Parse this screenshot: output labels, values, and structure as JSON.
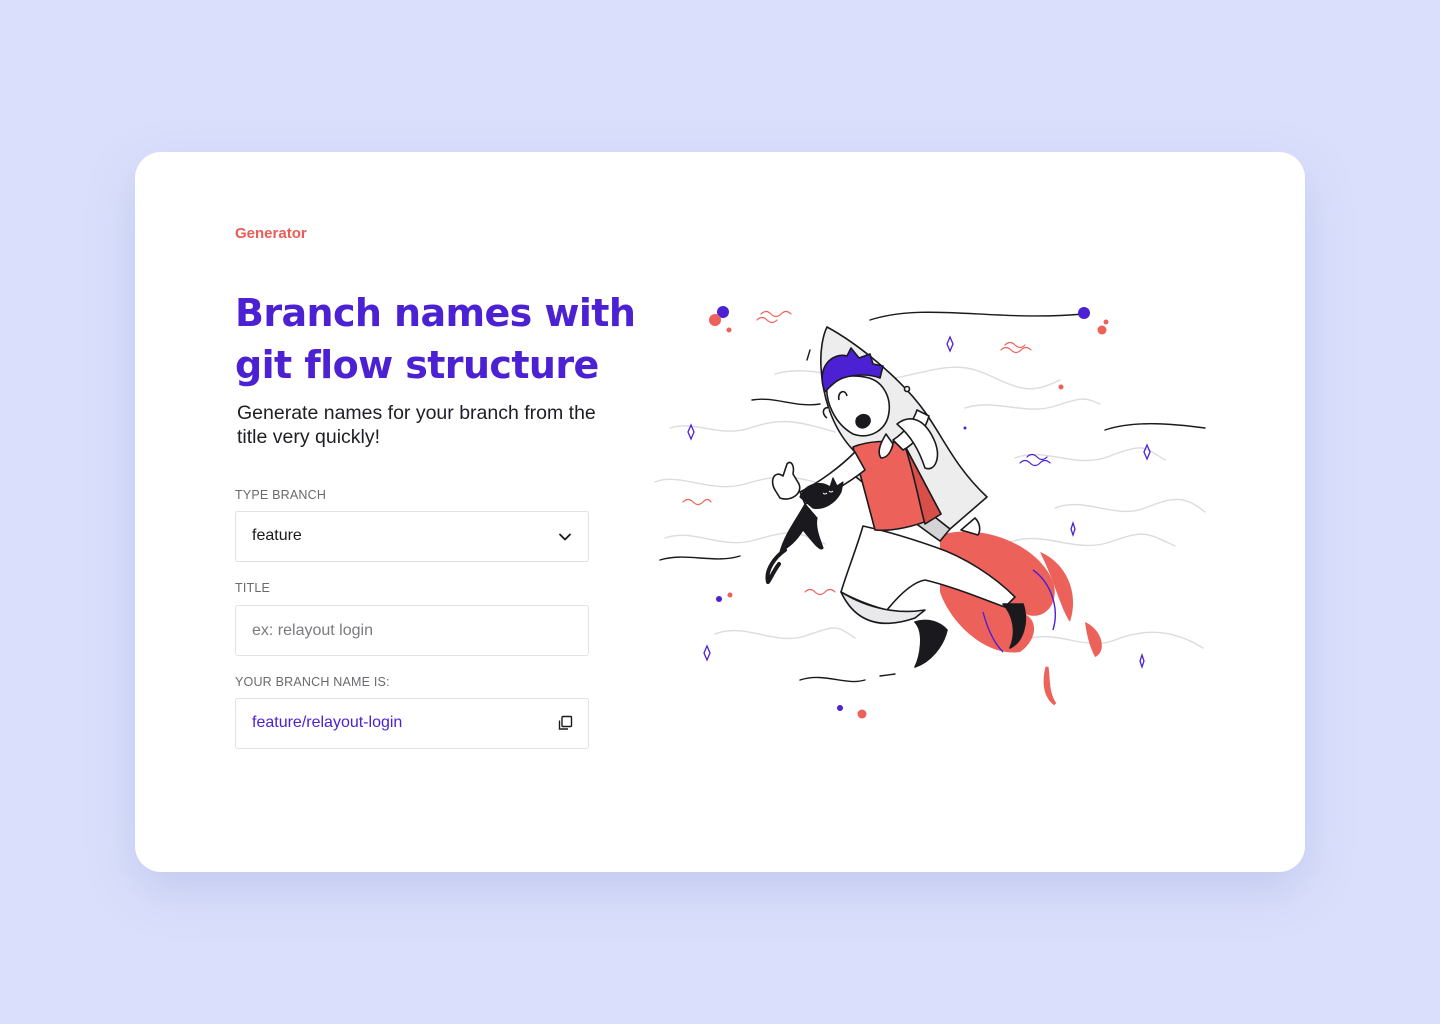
{
  "header": {
    "eyebrow": "Generator",
    "title": "Branch names with git flow structure",
    "subtitle": "Generate names for your branch from the title very quickly!"
  },
  "form": {
    "type_branch": {
      "label": "TYPE BRANCH",
      "selected": "feature",
      "icon": "chevron-down-icon"
    },
    "title": {
      "label": "TITLE",
      "placeholder": "ex: relayout login",
      "value": ""
    },
    "result": {
      "label": "YOUR BRANCH NAME IS:",
      "value": "feature/relayout-login",
      "icon": "copy-icon"
    }
  },
  "colors": {
    "page_bg": "#dae0fb",
    "accent": "#4c20d3",
    "eyebrow": "#ea5c54",
    "illustration_coral": "#ec615a"
  }
}
